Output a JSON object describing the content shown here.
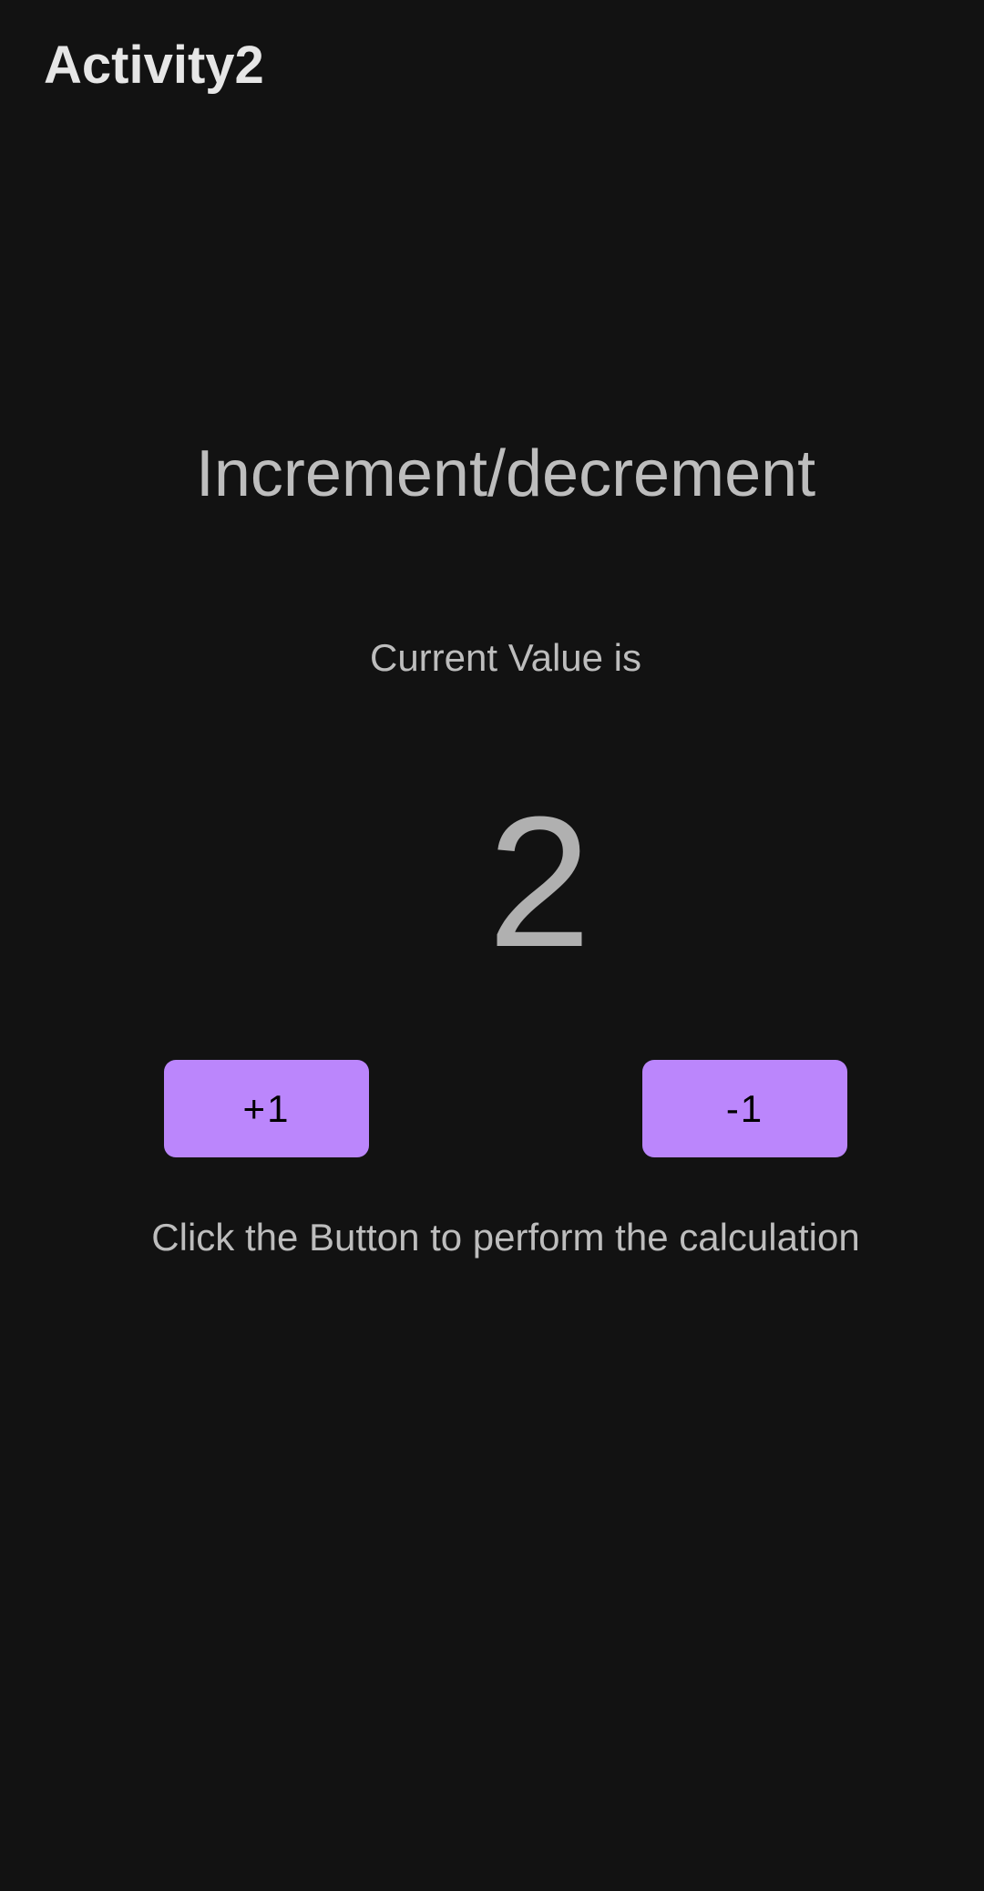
{
  "app_bar": {
    "title": "Activity2"
  },
  "main": {
    "headline": "Increment/decrement",
    "current_label": "Current Value is",
    "current_value": "2",
    "increment_label": "+1",
    "decrement_label": "-1",
    "hint": "Click the Button to perform the calculation"
  },
  "colors": {
    "background": "#121212",
    "button": "#bb86fc"
  }
}
